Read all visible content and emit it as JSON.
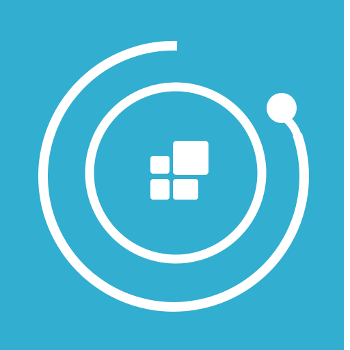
{
  "icon": {
    "name": "app-launcher-orbit-icon",
    "background_color": "#31AED0",
    "foreground_color": "#FFFFFF",
    "parts": [
      "outer-orbit-arc",
      "orbit-dot",
      "inner-ring",
      "app-grid-glyph"
    ]
  }
}
